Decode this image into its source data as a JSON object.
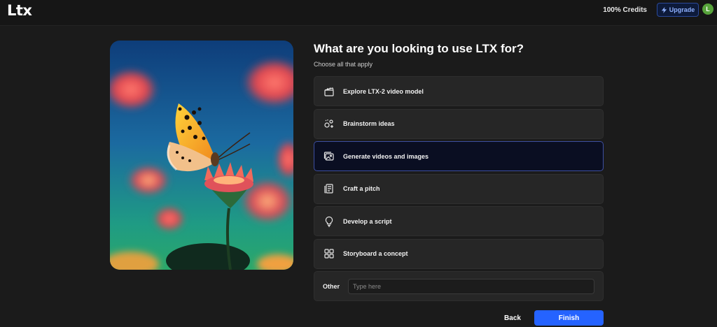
{
  "header": {
    "logo": "Ltx",
    "credits": "100% Credits",
    "upgrade_label": "Upgrade",
    "avatar_initial": "L"
  },
  "main": {
    "title": "What are you looking to use LTX for?",
    "subtitle": "Choose all that apply",
    "options": [
      {
        "label": "Explore LTX-2 video model",
        "icon": "clapperboard-icon",
        "selected": false
      },
      {
        "label": "Brainstorm ideas",
        "icon": "sparkle-ideas-icon",
        "selected": false
      },
      {
        "label": "Generate videos and images",
        "icon": "image-icon",
        "selected": true
      },
      {
        "label": "Craft a pitch",
        "icon": "document-icon",
        "selected": false
      },
      {
        "label": "Develop a script",
        "icon": "lightbulb-icon",
        "selected": false
      },
      {
        "label": "Storyboard a concept",
        "icon": "grid-icon",
        "selected": false
      }
    ],
    "other": {
      "label": "Other",
      "placeholder": "Type here",
      "value": ""
    },
    "back_label": "Back",
    "finish_label": "Finish"
  },
  "colors": {
    "accent": "#2563ff",
    "selected_border": "#3d4fa0",
    "avatar_bg": "#57a33b"
  }
}
